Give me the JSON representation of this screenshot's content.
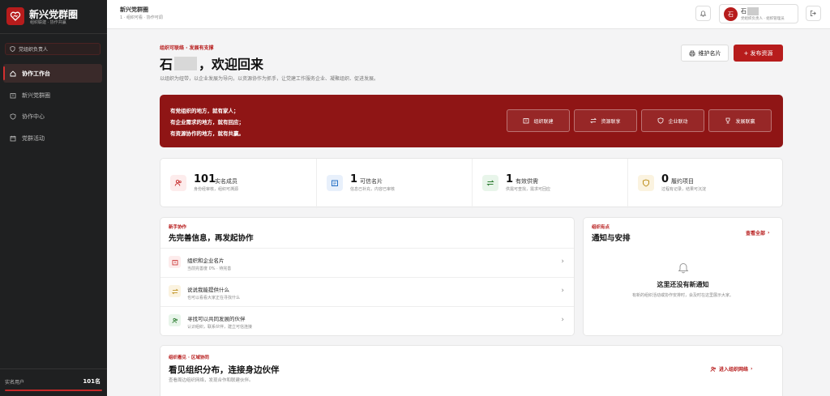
{
  "sidebar": {
    "brand_title": "新兴党群圈",
    "brand_sub": "组织联建 · 协作共赢",
    "org_select": "党组织负责人",
    "items": [
      {
        "label": "协作工作台",
        "icon": "home-icon"
      },
      {
        "label": "新兴党群圈",
        "icon": "building-icon"
      },
      {
        "label": "协作中心",
        "icon": "handshake-icon"
      },
      {
        "label": "党群活动",
        "icon": "calendar-icon"
      }
    ],
    "footer_label": "实名用户",
    "footer_value": "101名"
  },
  "topbar": {
    "title": "新兴党群圈",
    "subtitle": "1 · 组织可看 · 协作可调",
    "user_initial": "石",
    "user_name": "石",
    "user_role": "党组织负责人 · 组织管理员"
  },
  "hero": {
    "tag": "组织可联络 · 发展有支撑",
    "welcome_prefix": "石",
    "welcome_suffix": "，欢迎回来",
    "subtitle": "以组织为纽带，以企业发展为导向，以资源协作为抓手，让党建工作服务企业、凝聚组织、促进发展。",
    "btn_card": "维护名片",
    "btn_publish": "+ 发布资源"
  },
  "banner": {
    "lines": [
      "有党组织的地方，就有家人；",
      "有企业需求的地方，就有回应；",
      "有资源协作的地方，就有共赢。"
    ],
    "buttons": [
      {
        "label": "组织联建",
        "icon": "building-icon"
      },
      {
        "label": "资源联享",
        "icon": "swap-icon"
      },
      {
        "label": "企业联动",
        "icon": "handshake-icon"
      },
      {
        "label": "发展联赢",
        "icon": "trophy-icon"
      }
    ]
  },
  "stats": [
    {
      "num": "101",
      "label": "实名成员",
      "desc": "身份经审核，组织可溯源",
      "icon": "users-icon",
      "color": "#c62828",
      "bg": "#fdecec"
    },
    {
      "num": "1",
      "label": "可信名片",
      "desc": "信息已补充，内容已审核",
      "icon": "id-card-icon",
      "color": "#1565c0",
      "bg": "#e8f0fb"
    },
    {
      "num": "1",
      "label": "有效供需",
      "desc": "供需可查找，需求可回应",
      "icon": "swap-icon",
      "color": "#2e7d32",
      "bg": "#e8f5ea"
    },
    {
      "num": "0",
      "label": "履约项目",
      "desc": "过程有记录，结果可沉淀",
      "icon": "handshake-icon",
      "color": "#b8860b",
      "bg": "#fbf3e0"
    }
  ],
  "tasks": {
    "tag": "新手协作",
    "title": "先完善信息，再发起协作",
    "rows": [
      {
        "title": "组织和企业名片",
        "desc": "当前完善度 0% · 待完善",
        "icon": "building-icon",
        "color": "#c62828",
        "bg": "#fdecec"
      },
      {
        "title": "说说我能提供什么",
        "desc": "也可以看看大家正在寻找什么",
        "icon": "swap-icon",
        "color": "#b8860b",
        "bg": "#fbf3e0"
      },
      {
        "title": "寻找可以共同发展的伙伴",
        "desc": "认识组织，联系伙伴，建立可信连接",
        "icon": "users-icon",
        "color": "#2e7d32",
        "bg": "#e8f5ea"
      }
    ]
  },
  "notices": {
    "tag": "组织有点",
    "title": "通知与安排",
    "link": "查看全部",
    "empty_title": "这里还没有新通知",
    "empty_desc": "有新的组织活动或协作安排时，会及时在这里展示大家。"
  },
  "map": {
    "tag": "组织看见 · 区域协同",
    "title": "看见组织分布，连接身边伙伴",
    "subtitle": "查看周边组织网络，发现合作和联建伙伴。",
    "link": "进入组织网络"
  }
}
